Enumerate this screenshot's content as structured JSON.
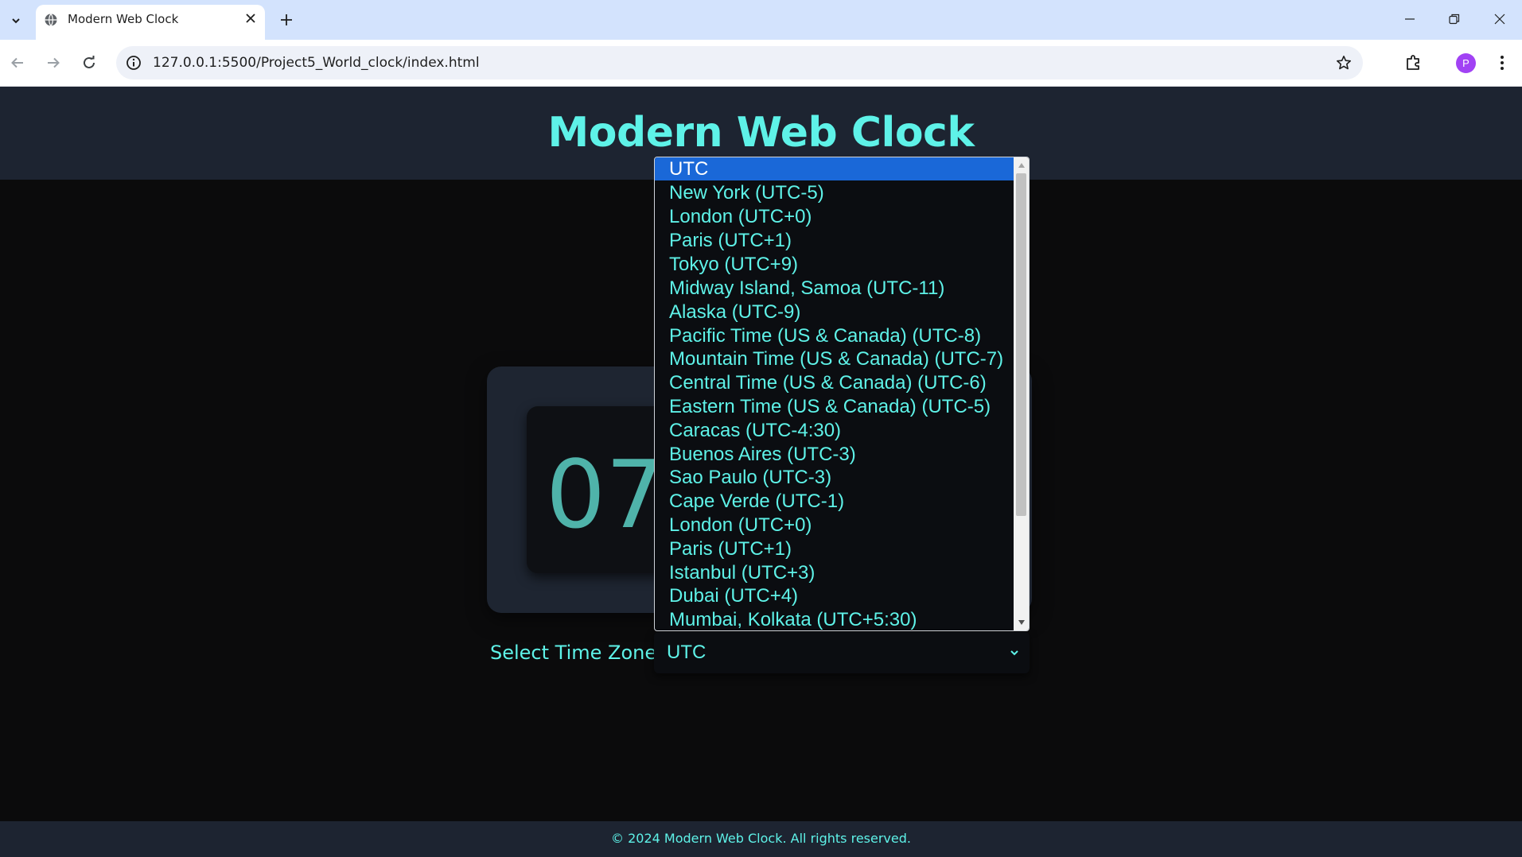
{
  "browser": {
    "tab_title": "Modern Web Clock",
    "url": "127.0.0.1:5500/Project5_World_clock/index.html",
    "profile_initial": "P"
  },
  "page": {
    "title": "Modern Web Clock",
    "clock_digits": "07",
    "timezone_label": "Select Time Zone:",
    "selected_timezone": "UTC",
    "timezone_options": [
      "UTC",
      "New York (UTC-5)",
      "London (UTC+0)",
      "Paris (UTC+1)",
      "Tokyo (UTC+9)",
      "Midway Island, Samoa (UTC-11)",
      "Alaska (UTC-9)",
      "Pacific Time (US & Canada) (UTC-8)",
      "Mountain Time (US & Canada) (UTC-7)",
      "Central Time (US & Canada) (UTC-6)",
      "Eastern Time (US & Canada) (UTC-5)",
      "Caracas (UTC-4:30)",
      "Buenos Aires (UTC-3)",
      "Sao Paulo (UTC-3)",
      "Cape Verde (UTC-1)",
      "London (UTC+0)",
      "Paris (UTC+1)",
      "Istanbul (UTC+3)",
      "Dubai (UTC+4)",
      "Mumbai, Kolkata (UTC+5:30)"
    ],
    "footer": "© 2024 Modern Web Clock. All rights reserved."
  },
  "colors": {
    "accent": "#5ef2e8",
    "header_bg": "#1d2431",
    "page_bg": "#0b0b0c",
    "selected_option_bg": "#1a68d8"
  }
}
